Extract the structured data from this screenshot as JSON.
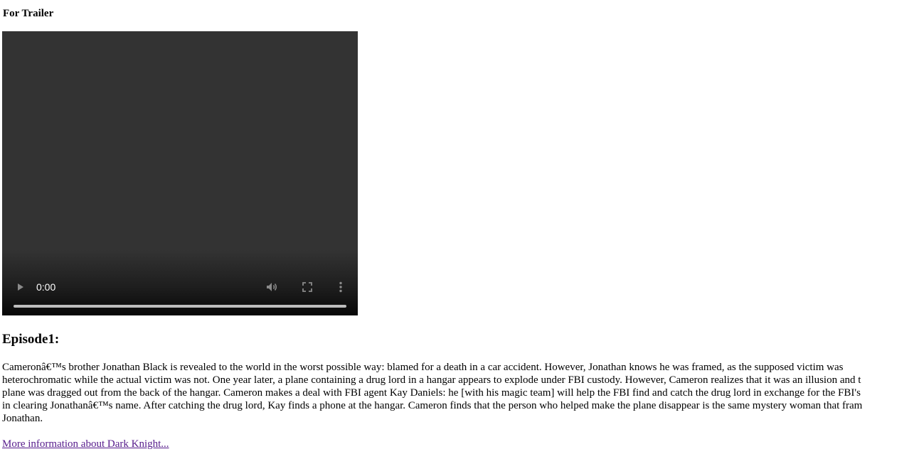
{
  "trailer": {
    "heading": "For Trailer"
  },
  "video": {
    "current_time": "0:00",
    "icons": {
      "play": "play-icon",
      "volume": "volume-icon",
      "fullscreen": "fullscreen-icon",
      "more": "more-options-icon"
    },
    "progress": 0
  },
  "episode": {
    "heading": "Episode1:",
    "synopsis_lines": [
      "Cameronâ€™s brother Jonathan Black is revealed to the world in the worst possible way: blamed for a death in a car accident. However, Jonathan knows he was framed, as the supposed victim was",
      "heterochromatic while the actual victim was not. One year later, a plane containing a drug lord in a hangar appears to explode under FBI custody. However, Cameron realizes that it was an illusion and t",
      "plane was dragged out from the back of the hangar. Cameron makes a deal with FBI agent Kay Daniels: he [with his magic team] will help the FBI find and catch the drug lord in exchange for the FBI's",
      "in clearing Jonathanâ€™s name. After catching the drug lord, Kay finds a phone at the hangar. Cameron finds that the person who helped make the plane disappear is the same mystery woman that fram",
      "Jonathan."
    ]
  },
  "more_info_link": "More information about Dark Knight..."
}
